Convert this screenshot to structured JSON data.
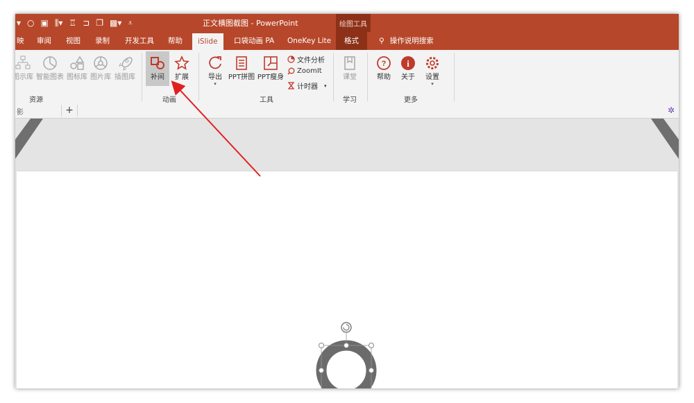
{
  "window": {
    "title": "正文横图截图  -  PowerPoint",
    "context_group": "绘图工具"
  },
  "tabs": {
    "t1": "映",
    "t2": "审阅",
    "t3": "视图",
    "t4": "录制",
    "t5": "开发工具",
    "t6": "帮助",
    "t7": "iSlide",
    "t8": "口袋动画 PA",
    "t9": "OneKey Lite",
    "t10": "格式",
    "tell_me": "操作说明搜索"
  },
  "ribbon": {
    "resources": {
      "label": "资源",
      "b1": "图示库",
      "b2": "智能图表",
      "b3": "图标库",
      "b4": "图片库",
      "b5": "插图库"
    },
    "animation": {
      "label": "动画",
      "tween": "补间",
      "extend": "扩展"
    },
    "tools": {
      "label": "工具",
      "export": "导出",
      "puzzle": "PPT拼图",
      "slim": "PPT瘦身",
      "file_analysis": "文件分析",
      "zoomit": "ZoomIt",
      "timer": "计时器"
    },
    "learn": {
      "label": "学习",
      "classroom": "课堂"
    },
    "more": {
      "label": "更多",
      "help": "帮助",
      "about": "关于",
      "settings": "设置"
    }
  },
  "doc_tabs": {
    "current": "影",
    "add": "+"
  },
  "colors": {
    "accent": "#b7472a",
    "context_tab": "#8c3118",
    "arrow": "#e02020",
    "ring": "#6b6b6b"
  }
}
